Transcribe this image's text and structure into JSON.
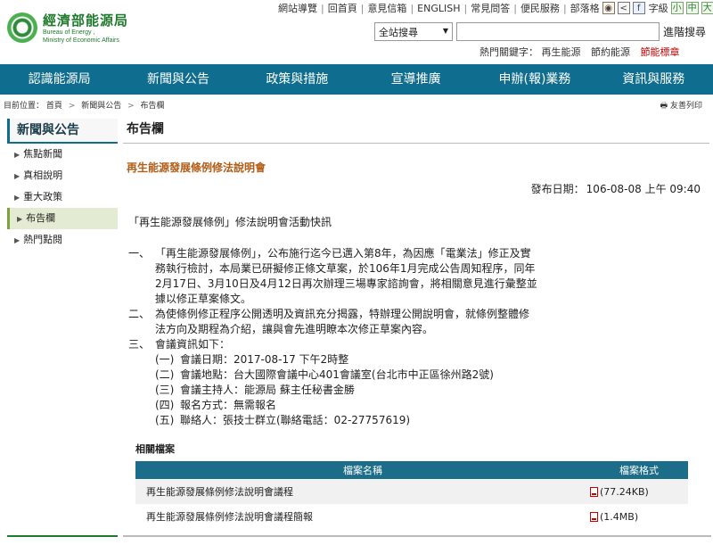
{
  "header": {
    "logo_zh": "經濟部能源局",
    "logo_en_line1": "Bureau of Energy ,",
    "logo_en_line2": "Ministry of Economic Affairs",
    "toplinks": [
      "網站導覽",
      "回首頁",
      "意見信箱",
      "ENGLISH",
      "常見問答",
      "便民服務",
      "部落格"
    ],
    "font_label": "字級",
    "font_sizes": [
      "小",
      "中",
      "大"
    ],
    "search_scope": "全站搜尋",
    "search_value": "",
    "search_button": "進階搜尋",
    "hot_label": "熱門關鍵字：",
    "hot_words": [
      "再生能源",
      "節約能源"
    ],
    "hot_word_highlight": "節能標章"
  },
  "nav": [
    "認識能源局",
    "新聞與公告",
    "政策與措施",
    "宣導推廣",
    "申辦(報)業務",
    "資訊與服務"
  ],
  "breadcrumb": {
    "label": "目前位置：",
    "items": [
      "首頁",
      "新聞與公告",
      "布告欄"
    ],
    "arrow": ">",
    "print": "友善列印"
  },
  "sidebar": {
    "title": "新聞與公告",
    "items": [
      "焦點新聞",
      "真相說明",
      "重大政策",
      "布告欄",
      "熱門點閱"
    ],
    "active_index": 3
  },
  "main": {
    "page_title": "布告欄",
    "article_title": "再生能源發展條例修法說明會",
    "pubdate_label": "發布日期：",
    "pubdate_value": "106-08-08 上午 09:40",
    "lead": "「再生能源發展條例」修法說明會活動快訊",
    "sections": [
      {
        "num": "一、",
        "lines": [
          "「再生能源發展條例」，公布施行迄今已邁入第8年，為因應「電業法」修正及實",
          "務執行檢討，本局業已研擬修正條文草案，於106年1月完成公告周知程序，同年",
          "2月17日、3月10日及4月12日再次辦理三場專家諮詢會，將相關意見進行彙整並",
          "據以修正草案條文。"
        ]
      },
      {
        "num": "二、",
        "lines": [
          "為使條例修正程序公開透明及資訊充分揭露，特辦理公開說明會，就條例整體修",
          "法方向及期程為介紹，讓與會先進明瞭本次修正草案內容。"
        ]
      },
      {
        "num": "三、",
        "lines": [
          "會議資訊如下："
        ]
      }
    ],
    "meeting_info": [
      {
        "num": "(一)",
        "text": "會議日期：2017-08-17 下午2時整"
      },
      {
        "num": "(二)",
        "text": "會議地點：台大國際會議中心401會議室(台北市中正區徐州路2號)"
      },
      {
        "num": "(三)",
        "text": "會議主持人：能源局 蘇主任秘書金勝"
      },
      {
        "num": "(四)",
        "text": "報名方式：無需報名"
      },
      {
        "num": "(五)",
        "text": "聯絡人：張技士群立(聯絡電話：02-27757619)"
      }
    ],
    "files": {
      "label": "相關檔案",
      "header_name": "檔案名稱",
      "header_format": "檔案格式",
      "rows": [
        {
          "name": "再生能源發展條例修法說明會議程",
          "format": "(77.24KB)"
        },
        {
          "name": "再生能源發展條例修法說明會議程簡報",
          "format": "(1.4MB)"
        }
      ]
    }
  },
  "colors": {
    "nav_bg": "#0f6d8f",
    "brand_green": "#1f7a2c",
    "article_title": "#b25c16",
    "hot_word": "#bb0000"
  }
}
